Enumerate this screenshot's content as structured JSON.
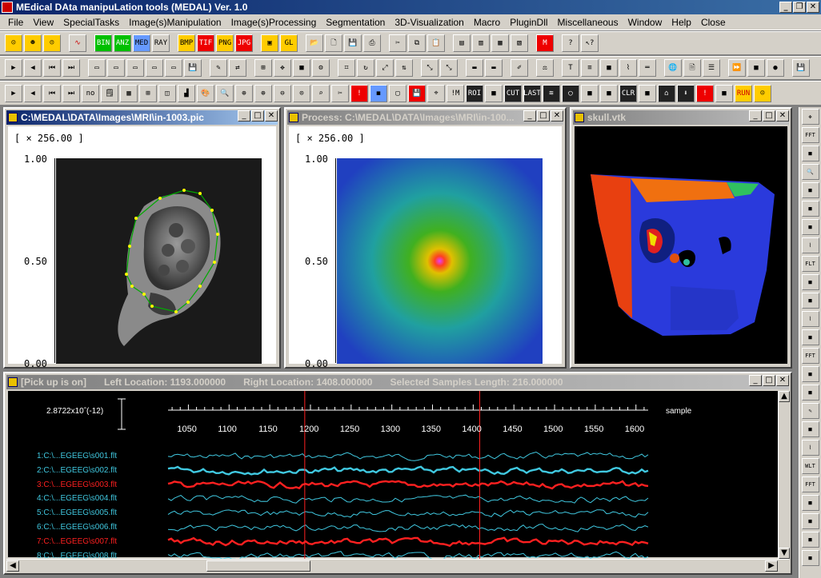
{
  "app": {
    "title": "MEdical DAta manipuLation tools (MEDAL) Ver. 1.0"
  },
  "menu": [
    "File",
    "View",
    "SpecialTasks",
    "Image(s)Manipulation",
    "Image(s)Processing",
    "Segmentation",
    "3D-Visualization",
    "Macro",
    "PluginDll",
    "Miscellaneous",
    "Window",
    "Help",
    "Close"
  ],
  "toolbar1": [
    "BIN",
    "ANZ",
    "MED",
    "RAY",
    "BMP",
    "TIF",
    "PNG",
    "JPG",
    "GL"
  ],
  "toolbar3": [
    "no",
    "ROI",
    "CUT",
    "LAST",
    "CLR",
    "RUN"
  ],
  "win_mri": {
    "title": "C:\\MEDAL\\DATA\\Images\\MRI\\in-1003.pic",
    "scale": "[ × 256.00 ]",
    "yticks": [
      "1.00",
      "0.50",
      "0.00"
    ]
  },
  "win_proc": {
    "title": "Process: C:\\MEDAL\\DATA\\Images\\MRI\\in-100...",
    "scale": "[ × 256.00 ]",
    "yticks": [
      "1.00",
      "0.50",
      "0.00"
    ]
  },
  "win_skull": {
    "title": "skull.vtk"
  },
  "win_sig": {
    "pickup": "[Pick up is on]",
    "left": "Left Location:  1193.000000",
    "right": "Right Location: 1408.000000",
    "sel": "Selected Samples Length: 216.000000",
    "scale_label": "2.8722x10ˆ(-12)",
    "xunit": "sample",
    "xticks": [
      "1050",
      "1100",
      "1150",
      "1200",
      "1250",
      "1300",
      "1350",
      "1400",
      "1450",
      "1500",
      "1550",
      "1600"
    ],
    "channels": [
      {
        "label": "1:C:\\...EGEEG\\s001.flt",
        "color": "#40c8e0"
      },
      {
        "label": "2:C:\\...EGEEG\\s002.flt",
        "color": "#40c8e0"
      },
      {
        "label": "3:C:\\...EGEEG\\s003.flt",
        "color": "#ff2020"
      },
      {
        "label": "4:C:\\...EGEEG\\s004.flt",
        "color": "#40c8e0"
      },
      {
        "label": "5:C:\\...EGEEG\\s005.flt",
        "color": "#40c8e0"
      },
      {
        "label": "6:C:\\...EGEEG\\s006.flt",
        "color": "#40c8e0"
      },
      {
        "label": "7:C:\\...EGEEG\\s007.flt",
        "color": "#ff2020"
      },
      {
        "label": "8:C:\\...EGEEG\\s008.flt",
        "color": "#40c8e0"
      }
    ]
  },
  "colors": {
    "title_active": "#0a246a",
    "face": "#d4d0c8",
    "signal_bg": "#000000",
    "cursor": "#ff2020"
  }
}
